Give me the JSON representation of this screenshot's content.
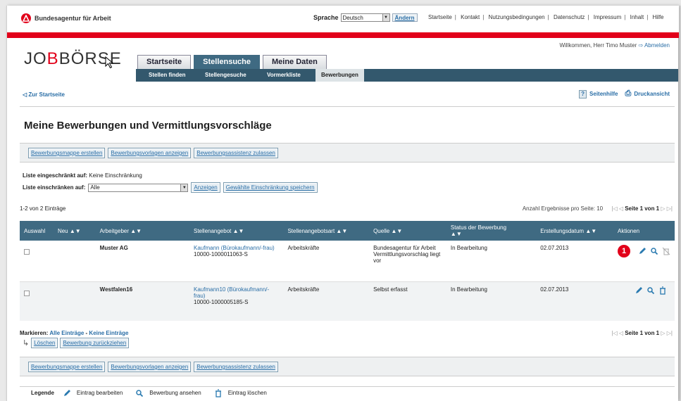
{
  "header": {
    "ba_logo_text": "Bundesagentur für Arbeit",
    "language_label": "Sprache",
    "language_value": "Deutsch",
    "change_button": "Ändern",
    "top_links": [
      "Startseite",
      "Kontakt",
      "Nutzungsbedingungen",
      "Datenschutz",
      "Impressum",
      "Inhalt",
      "Hilfe"
    ],
    "welcome": "Willkommen, Herr Timo Muster",
    "logout": "Abmelden",
    "logo_part1": "JO",
    "logo_part2": "B",
    "logo_part3": "BÖRSE"
  },
  "tabs": [
    "Startseite",
    "Stellensuche",
    "Meine Daten"
  ],
  "subnav": [
    "Stellen finden",
    "Stellengesuche",
    "Vormerkliste",
    "Bewerbungen"
  ],
  "nav": {
    "back": "Zur Startseite",
    "help": "Seitenhilfe",
    "print": "Druckansicht"
  },
  "page_title": "Meine Bewerbungen und Vermittlungsvorschläge",
  "buttons": {
    "mappe": "Bewerbungsmappe erstellen",
    "vorlagen": "Bewerbungsvorlagen anzeigen",
    "assistenz": "Bewerbungsassistenz zulassen"
  },
  "filter": {
    "restricted_label": "Liste eingeschränkt auf:",
    "restricted_value": "Keine Einschränkung",
    "restrict_label": "Liste einschränken auf:",
    "restrict_value": "Alle",
    "show_button": "Anzeigen",
    "save_button": "Gewählte Einschränkung speichern"
  },
  "results": {
    "count": "1-2 von 2 Einträge",
    "per_page": "Anzahl Ergebnisse pro Seite: 10",
    "page": "Seite 1 von 1"
  },
  "table": {
    "headers": [
      "Auswahl",
      "Neu",
      "Arbeitgeber",
      "Stellenangebot",
      "Stellenangebotsart",
      "Quelle",
      "Status der Bewerbung",
      "Erstellungsdatum",
      "Aktionen"
    ],
    "rows": [
      {
        "employer": "Muster AG",
        "offer_title": "Kaufmann (Bürokaufmann/-frau)",
        "offer_id": "10000-1000011063-S",
        "type": "Arbeitskräfte",
        "source": "Bundesagentur für Arbeit Vermittlungsvorschlag liegt vor",
        "status": "In Bearbeitung",
        "date": "02.07.2013",
        "badge": "1"
      },
      {
        "employer": "Westfalen16",
        "offer_title": "Kaufmann10 (Bürokaufmann/-frau)",
        "offer_id": "10000-1000005185-S",
        "type": "Arbeitskräfte",
        "source": "Selbst erfasst",
        "status": "In Bearbeitung",
        "date": "02.07.2013"
      }
    ]
  },
  "mark": {
    "label": "Markieren:",
    "all": "Alle Einträge",
    "sep": " - ",
    "none": "Keine Einträge"
  },
  "actions": {
    "delete": "Löschen",
    "withdraw": "Bewerbung zurückziehen"
  },
  "legend": {
    "title": "Legende",
    "edit": "Eintrag bearbeiten",
    "view": "Bewerbung ansehen",
    "delete": "Eintrag löschen"
  },
  "colors": {
    "accent_red": "#e2001a",
    "nav_blue": "#3f6a82",
    "link_blue": "#2a6ea6"
  }
}
